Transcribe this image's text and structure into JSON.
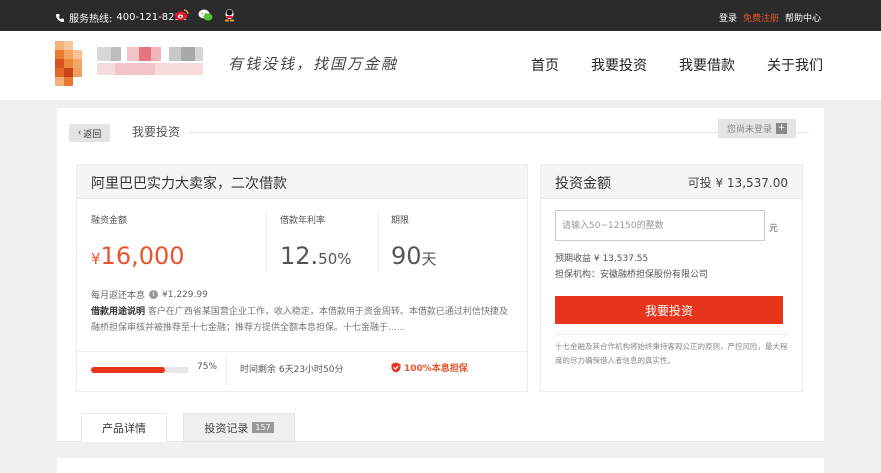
{
  "topbar": {
    "hotline_label": "服务热线:",
    "hotline_number": "400-121-8232",
    "social_icons": [
      "weibo-icon",
      "wechat-icon",
      "qq-icon"
    ],
    "login": "登录",
    "register": "免费注册",
    "help": "帮助中心"
  },
  "header": {
    "slogan": "有钱没钱，找国万金融",
    "nav": [
      "首页",
      "我要投资",
      "我要借款",
      "关于我们"
    ]
  },
  "breadcrumb": {
    "back": "返回",
    "title": "我要投资",
    "login_tag": "您尚未登录"
  },
  "product": {
    "title": "阿里巴巴实力大卖家，二次借款",
    "amount_label": "融资金额",
    "amount_currency": "¥",
    "amount_value": "16,000",
    "rate_label": "借款年利率",
    "rate_int": "12.",
    "rate_frac": "50%",
    "term_label": "期限",
    "term_value": "90",
    "term_unit": "天",
    "monthly_label": "每月返还本息",
    "monthly_value": "¥1,229.99",
    "desc_label": "借款用途说明",
    "desc_text": "客户在广西省某国营企业工作，收入稳定，本借款用于资金周转。本借款已通过利信快捷及 融桥担保审核并被推荐至十七金融；推荐方提供全额本息担保。十七金融于......",
    "progress_percent": 75,
    "progress_label": "75%",
    "remaining": "时间剩余 6天23小时50分",
    "guarantee": "100%本息担保"
  },
  "invest": {
    "title": "投资金额",
    "available": "可投 ¥ 13,537.00",
    "input_placeholder": "请输入50~12150的整数",
    "unit": "元",
    "expected": "预期收益 ¥ 13,537.55",
    "guarantor": "担保机构：安徽融桥担保股份有限公司",
    "button": "我要投资",
    "note": "十七金融及其合作机构将始终秉持客观公正的原则，严控风险，最大程度的尽力确保借入者信息的真实性。"
  },
  "tabs": {
    "detail": "产品详情",
    "records": "投资记录",
    "records_count": "157"
  },
  "colors": {
    "accent": "#e8341a",
    "accent_text": "#e8542c",
    "topbar_bg": "#2b2b2b"
  }
}
